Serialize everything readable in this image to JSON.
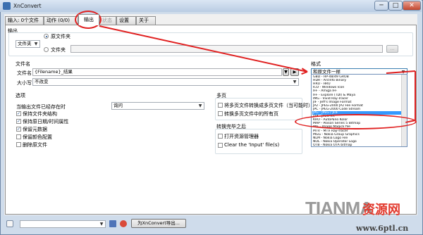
{
  "window": {
    "title": "XnConvert",
    "minimize": "─",
    "maximize": "□",
    "close": "✕"
  },
  "tabs": [
    {
      "label": "输入: 0个文件"
    },
    {
      "label": "动作 (0/0)"
    },
    {
      "label": "输出"
    },
    {
      "label": "状态"
    },
    {
      "label": "设置"
    },
    {
      "label": "关于"
    }
  ],
  "output": {
    "section_label": "输出",
    "destination_select": "文件夹",
    "radio_original": "原文件夹",
    "radio_folder": "文件夹",
    "folder_path": "",
    "browse_label": "..."
  },
  "filename": {
    "section_label": "文件名",
    "name_label": "文件名",
    "name_value": "{Filename}_结果",
    "case_label": "大小写",
    "case_value": "不改变"
  },
  "options": {
    "section_label": "选项",
    "exists_label": "当输出文件已经存在时",
    "exists_value": "询问",
    "checkboxes": [
      {
        "label": "保持文件夹结构",
        "checked": true
      },
      {
        "label": "保持原日期/时间属性",
        "checked": true
      },
      {
        "label": "保留元数据",
        "checked": true
      },
      {
        "label": "保留颜色配置",
        "checked": false
      },
      {
        "label": "删除原文件",
        "checked": false
      }
    ]
  },
  "multipage": {
    "section_label": "多页",
    "checkboxes": [
      {
        "label": "将多页文件转换成多页文件（当可能时）",
        "checked": false
      },
      {
        "label": "转换多页文件中的所有页",
        "checked": false
      }
    ]
  },
  "after_convert": {
    "section_label": "转换完毕之后",
    "checkboxes": [
      {
        "label": "打开资源管理器",
        "checked": false
      },
      {
        "label": "Clear the 'Input' file(s)",
        "checked": false
      }
    ]
  },
  "format": {
    "section_label": "格式",
    "selected": "和原文件一样",
    "selected_list_index": 10,
    "list": [
      "GBD - HP-48/49 GROB",
      "HDR - ArcInfo Binary",
      "HRU - HRU",
      "ICO - Windows Icon",
      "IFF - Amiga IFF",
      "IFF - Explore (TDI) & Maya",
      "IMG - Vivid Ray-Tracer",
      "JIF - Jeff's Image Format",
      "JP2 - JPEG-2000 JP2 File Format",
      "JPC - JPEG-2000 Code Stream",
      "JPG - JPEG / JFIF",
      "JXR - JPEG XR",
      "KRO - AutoPano Kolor",
      "MAP - Poison Series 5 Bitmap",
      "MIF - Image Magick file",
      "MTV - MTV Ray-Tracer",
      "MGG - Nokia Group Graphics",
      "NLM - Nokia Logo File",
      "NOL - Nokia Operator Logo",
      "OTB - Nokia OTA bitmap"
    ]
  },
  "bottom": {
    "preset_value": "",
    "export_label": "为XnConvert导出..."
  },
  "watermark": {
    "latin": "TIANMA",
    "cn": "资源网",
    "url": "www.6ptl.cn"
  },
  "colors": {
    "accent": "#3399ff",
    "annotation": "#e02020"
  }
}
